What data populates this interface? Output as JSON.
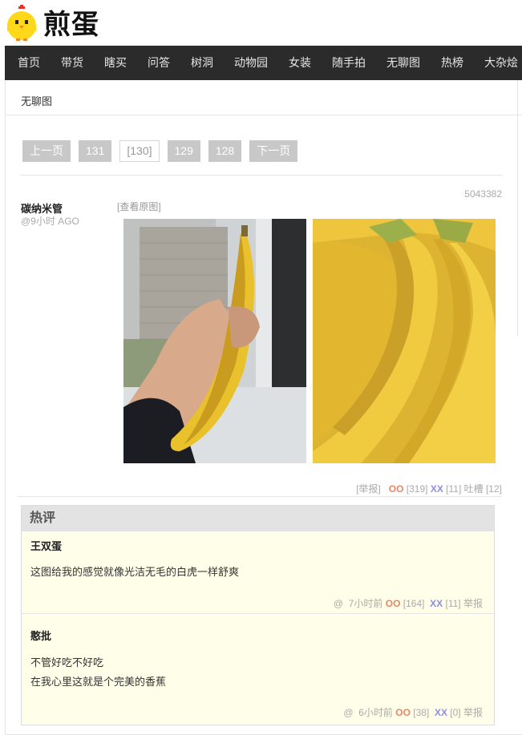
{
  "logo": {
    "text": "煎蛋",
    "mascot_icon": "yellow-chick-icon"
  },
  "nav": {
    "items": [
      {
        "label": "首页"
      },
      {
        "label": "带货"
      },
      {
        "label": "瞎买"
      },
      {
        "label": "问答"
      },
      {
        "label": "树洞"
      },
      {
        "label": "动物园"
      },
      {
        "label": "女装"
      },
      {
        "label": "随手拍"
      },
      {
        "label": "无聊图"
      },
      {
        "label": "热榜"
      },
      {
        "label": "大杂烩"
      }
    ]
  },
  "breadcrumb": "无聊图",
  "pager": {
    "prev": "上一页",
    "pages": [
      "131",
      "[130]",
      "129",
      "128"
    ],
    "next": "下一页",
    "current_index": 1
  },
  "post": {
    "id": "5043382",
    "author": "碳纳米管",
    "time": "@9小时 AGO",
    "view_original": "[查看原图]",
    "report": "[举报]",
    "oo_label": "OO",
    "oo_count": "[319]",
    "xx_label": "XX",
    "xx_count": "[11]",
    "tucao": "吐槽 [12]"
  },
  "hot_comments": {
    "title": "热评",
    "items": [
      {
        "author": "王双蛋",
        "lines": [
          "这图给我的感觉就像光洁无毛的白虎一样舒爽"
        ],
        "at": "@",
        "time": "7小时前",
        "oo_label": "OO",
        "oo_count": "[164]",
        "xx_label": "XX",
        "xx_count": "[11]",
        "report": "举报"
      },
      {
        "author": "憨批",
        "lines": [
          "不管好吃不好吃",
          "在我心里这就是个完美的香蕉"
        ],
        "at": "@",
        "time": "6小时前",
        "oo_label": "OO",
        "oo_count": "[38]",
        "xx_label": "XX",
        "xx_count": "[0]",
        "report": "举报"
      }
    ]
  },
  "colors": {
    "nav_bg": "#2b2b2b",
    "pager_bg": "#c8c8c8",
    "oo": "#e7866a",
    "xx": "#8e8ee8",
    "comment_bg": "#ffffe9"
  }
}
